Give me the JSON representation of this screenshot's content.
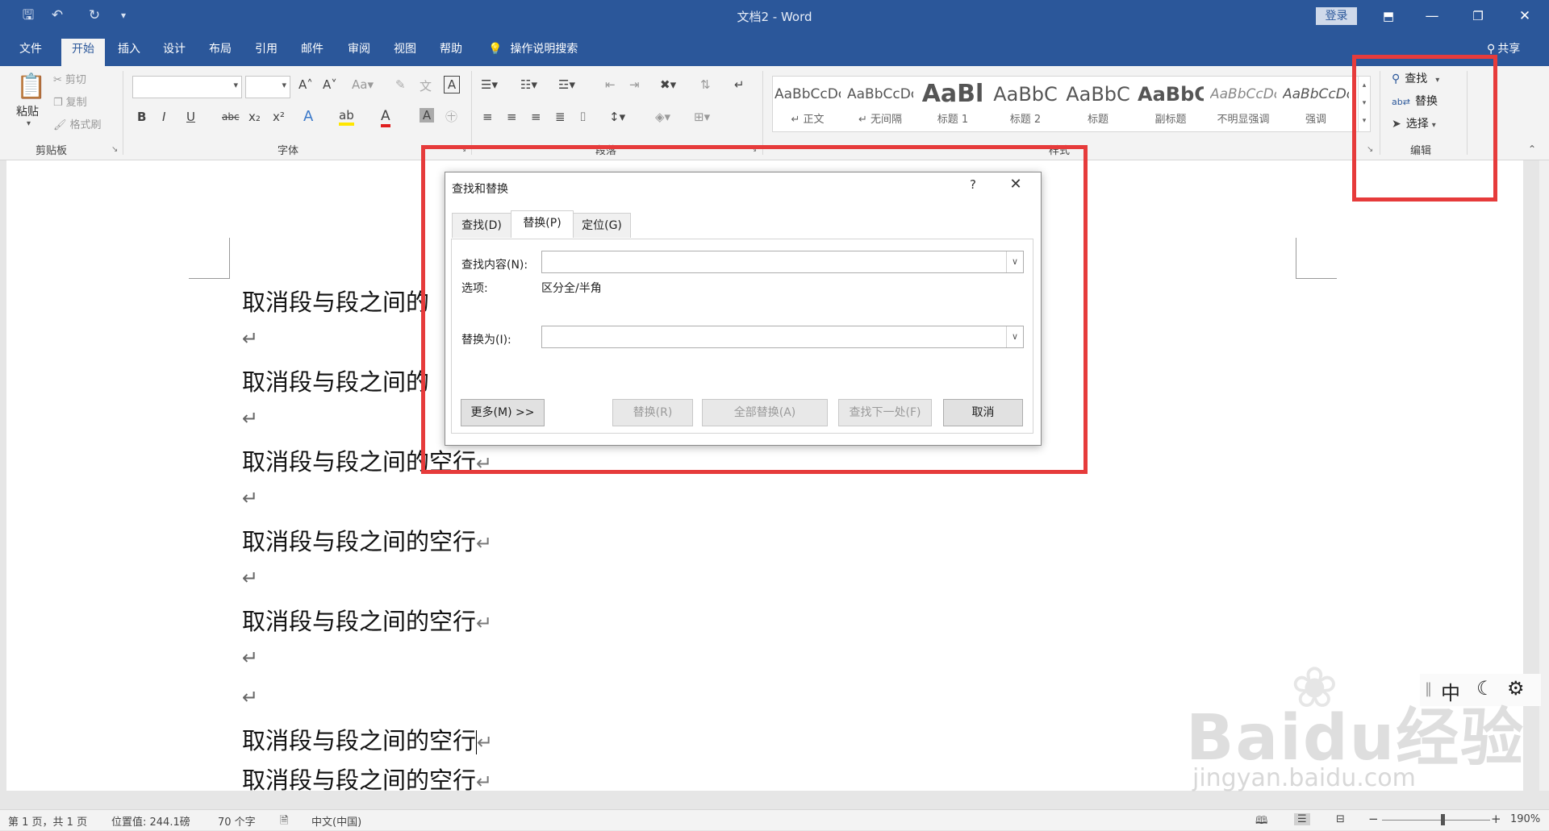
{
  "titlebar": {
    "doc_title": "文档2  -  Word",
    "login": "登录",
    "qat_icons": [
      "save-icon",
      "undo-icon",
      "redo-icon",
      "customize-icon"
    ]
  },
  "tabs": [
    {
      "label": "文件"
    },
    {
      "label": "开始"
    },
    {
      "label": "插入"
    },
    {
      "label": "设计"
    },
    {
      "label": "布局"
    },
    {
      "label": "引用"
    },
    {
      "label": "邮件"
    },
    {
      "label": "审阅"
    },
    {
      "label": "视图"
    },
    {
      "label": "帮助"
    }
  ],
  "active_tab": "开始",
  "tell_me": "操作说明搜索",
  "share": "共享",
  "clipboard": {
    "paste": "粘贴",
    "cut": "剪切",
    "copy": "复制",
    "format_painter": "格式刷",
    "label": "剪贴板"
  },
  "font_group": {
    "font_name": "",
    "font_size": "",
    "label": "字体",
    "buttons": [
      "B",
      "I",
      "U",
      "abc",
      "x₂",
      "x²"
    ]
  },
  "paragraph_group": {
    "label": "段落"
  },
  "styles_group": {
    "label": "样式",
    "items": [
      {
        "sample": "AaBbCcDc",
        "name": "↵ 正文"
      },
      {
        "sample": "AaBbCcDc",
        "name": "↵ 无间隔"
      },
      {
        "sample": "AaBl",
        "name": "标题 1"
      },
      {
        "sample": "AaBbC",
        "name": "标题 2"
      },
      {
        "sample": "AaBbC",
        "name": "标题"
      },
      {
        "sample": "AaBbC",
        "name": "副标题"
      },
      {
        "sample": "AaBbCcDc",
        "name": "不明显强调"
      },
      {
        "sample": "AaBbCcDc",
        "name": "强调"
      }
    ]
  },
  "editing_group": {
    "find": "查找",
    "replace": "替换",
    "select": "选择",
    "label": "编辑"
  },
  "document": {
    "paragraphs": [
      "取消段与段之间的",
      "取消段与段之间的",
      "取消段与段之间的空行",
      "取消段与段之间的空行",
      "取消段与段之间的空行",
      "取消段与段之间的空行",
      "取消段与段之间的空行"
    ],
    "pilcrow": "↵"
  },
  "dialog": {
    "title": "查找和替换",
    "help": "?",
    "tabs": [
      "查找(D)",
      "替换(P)",
      "定位(G)"
    ],
    "find_label": "查找内容(N):",
    "find_value": "",
    "options_label": "选项:",
    "options_value": "区分全/半角",
    "replace_label": "替换为(I):",
    "replace_value": "",
    "buttons": {
      "more": "更多(M) >>",
      "replace": "替换(R)",
      "replace_all": "全部替换(A)",
      "find_next": "查找下一处(F)",
      "cancel": "取消"
    }
  },
  "ime": {
    "mode": "中"
  },
  "watermark": {
    "main": "Baidu经验",
    "sub": "jingyan.baidu.com"
  },
  "statusbar": {
    "page": "第 1 页，共 1 页",
    "position": "位置值: 244.1磅",
    "words": "70 个字",
    "language": "中文(中国)",
    "zoom": "190%",
    "zoom_minus": "−",
    "zoom_plus": "+"
  },
  "colors": {
    "ribbon_blue": "#2b579a",
    "highlight_red": "#e63b3b"
  }
}
